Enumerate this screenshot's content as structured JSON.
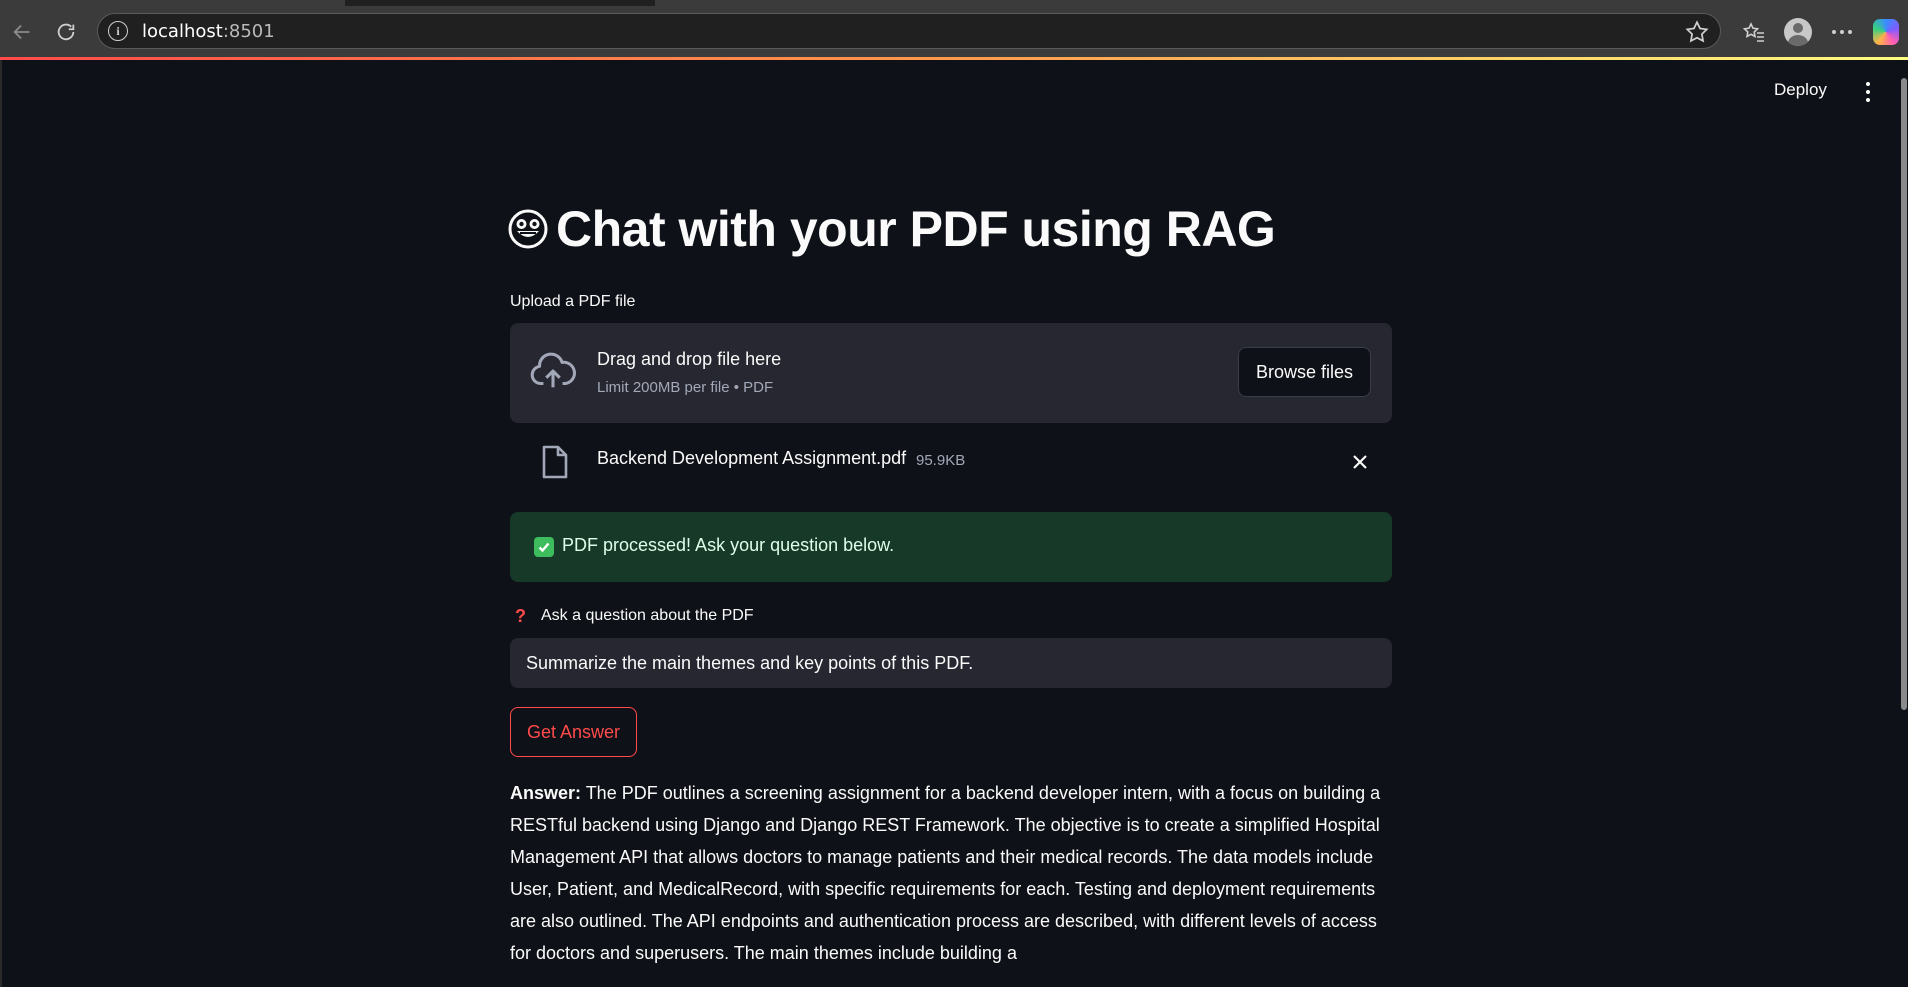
{
  "browser": {
    "url_host": "localhost",
    "url_port": ":8501"
  },
  "header": {
    "deploy_label": "Deploy"
  },
  "main": {
    "title": "Chat with your PDF using RAG",
    "upload_label": "Upload a PDF file",
    "dropzone_title": "Drag and drop file here",
    "dropzone_limit": "Limit 200MB per file • PDF",
    "browse_label": "Browse files",
    "file": {
      "name": "Backend Development Assignment.pdf",
      "size": "95.9KB"
    },
    "success_message": "PDF processed! Ask your question below.",
    "question_label": "Ask a question about the PDF",
    "question_value": "Summarize the main themes and key points of this PDF.",
    "get_answer_label": "Get Answer",
    "answer_label": "Answer:",
    "answer_text": " The PDF outlines a screening assignment for a backend developer intern, with a focus on building a RESTful backend using Django and Django REST Framework. The objective is to create a simplified Hospital Management API that allows doctors to manage patients and their medical records. The data models include User, Patient, and MedicalRecord, with specific requirements for each. Testing and deployment requirements are also outlined. The API endpoints and authentication process are described, with different levels of access for doctors and superusers. The main themes include building a"
  },
  "colors": {
    "accent": "#ff4b4b",
    "background": "#0e1117",
    "success_bg": "#173928",
    "input_bg": "#262730"
  },
  "icons": [
    "back-arrow-icon",
    "reload-icon",
    "info-icon",
    "star-icon",
    "favorites-icon",
    "profile-icon",
    "more-icon",
    "copilot-icon",
    "menu-icon",
    "cloud-upload-icon",
    "file-icon",
    "close-icon",
    "check-icon",
    "question-mark-icon",
    "emoji-icon"
  ]
}
